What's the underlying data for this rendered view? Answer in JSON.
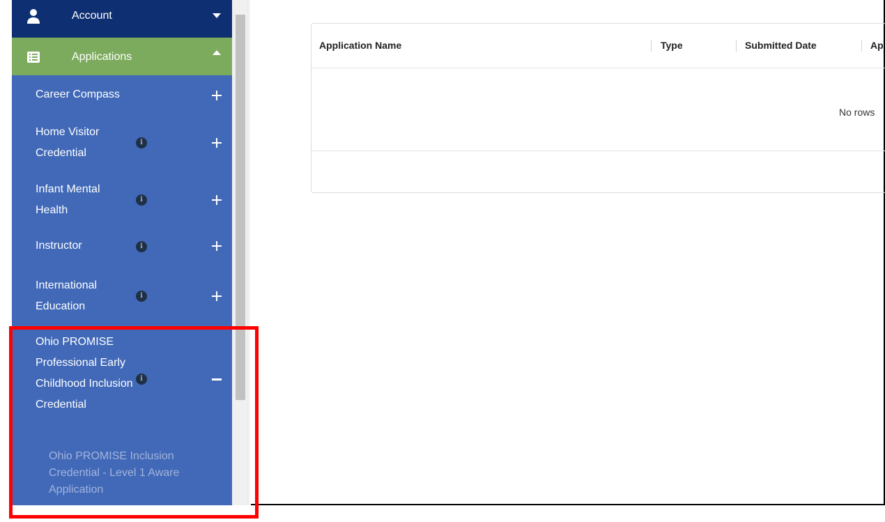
{
  "sidebar": {
    "account": {
      "label": "Account",
      "icon": "user-icon"
    },
    "applications": {
      "label": "Applications",
      "icon": "list-icon"
    },
    "items": [
      {
        "label": "Career Compass"
      },
      {
        "label": "Home Visitor Credential"
      },
      {
        "label": "Infant Mental Health"
      },
      {
        "label": "Instructor"
      },
      {
        "label": "International Education"
      },
      {
        "label": "Ohio PROMISE Professional Early Childhood Inclusion Credential",
        "expanded": true
      }
    ],
    "sub_item": {
      "label": "Ohio PROMISE Inclusion Credential - Level 1 Aware Application"
    }
  },
  "grid": {
    "columns": [
      "Application Name",
      "Type",
      "Submitted Date",
      "Ap"
    ],
    "empty_text": "No rows"
  },
  "colors": {
    "account_bg": "#0e3072",
    "applications_bg": "#7cab5d",
    "sidebar_bg": "#4169b8",
    "highlight": "#ff0000"
  }
}
